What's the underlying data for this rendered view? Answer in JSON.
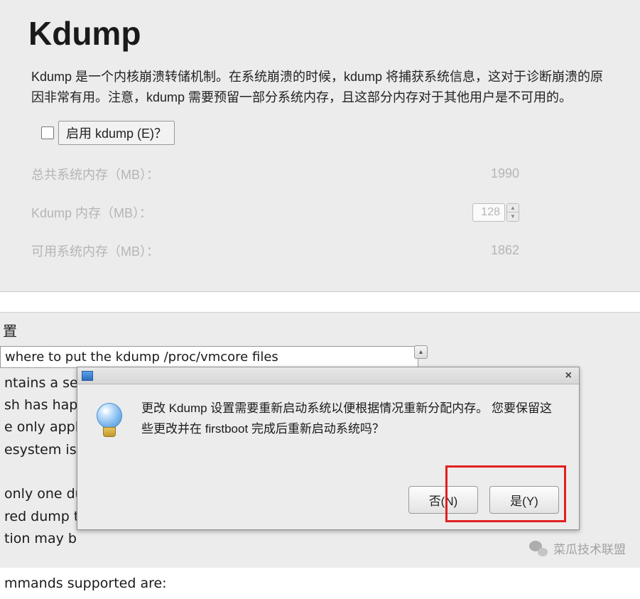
{
  "page": {
    "title": "Kdump",
    "description": "Kdump 是一个内核崩溃转储机制。在系统崩溃的时候，kdump 将捕获系统信息，这对于诊断崩溃的原因非常有用。注意，kdump 需要预留一部分系统内存，且这部分内存对于其他用户是不可用的。"
  },
  "enable": {
    "label": "启用 kdump (E)？",
    "checked": false
  },
  "memory": {
    "total_label": "总共系统内存（MB）：",
    "total_value": "1990",
    "kdump_label": "Kdump 内存（MB）：",
    "kdump_value": "128",
    "avail_label": "可用系统内存（MB）：",
    "avail_value": "1862"
  },
  "bottom": {
    "header": "置",
    "config_top_line": " where to put the kdump /proc/vmcore files",
    "config_body": "ntains a se\nsh has happ\ne only appli\nesystem is\n\nonly one du\nred dump t\ntion may b\n\nmmands supported are:"
  },
  "dialog": {
    "message": "更改 Kdump 设置需要重新启动系统以便根据情况重新分配内存。 您要保留这些更改并在 firstboot 完成后重新启动系统吗？",
    "no_label": "否(N)",
    "yes_label": "是(Y)"
  },
  "footer": {
    "wechat": "菜瓜技术联盟"
  }
}
